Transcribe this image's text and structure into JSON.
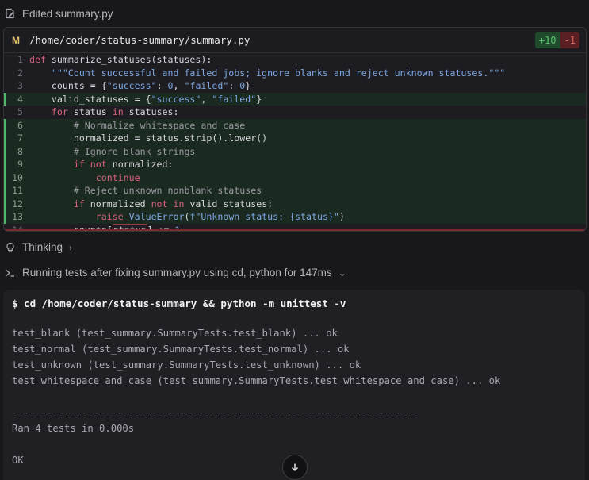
{
  "edit_header": {
    "label": "Edited summary.py",
    "icon": "edit-file-icon"
  },
  "editor": {
    "badge": "M",
    "file_path": "/home/coder/status-summary/summary.py",
    "additions": "+10",
    "deletions": "-1",
    "colors": {
      "added": "#4fb765",
      "removed": "#e0605a",
      "modified_badge": "#e5c36a"
    }
  },
  "thinking": {
    "label": "Thinking",
    "icon": "lightbulb-icon"
  },
  "run": {
    "label": "Running tests after fixing summary.py using cd, python for 147ms",
    "icon": "terminal-prompt-icon"
  },
  "terminal": {
    "command": "$ cd /home/coder/status-summary && python -m unittest -v",
    "output": [
      "test_blank (test_summary.SummaryTests.test_blank) ... ok",
      "test_normal (test_summary.SummaryTests.test_normal) ... ok",
      "test_unknown (test_summary.SummaryTests.test_unknown) ... ok",
      "test_whitespace_and_case (test_summary.SummaryTests.test_whitespace_and_case) ... ok",
      "",
      "----------------------------------------------------------------------",
      "Ran 4 tests in 0.000s",
      "",
      "OK"
    ]
  },
  "scroll_button": {
    "icon": "arrow-down-icon"
  }
}
